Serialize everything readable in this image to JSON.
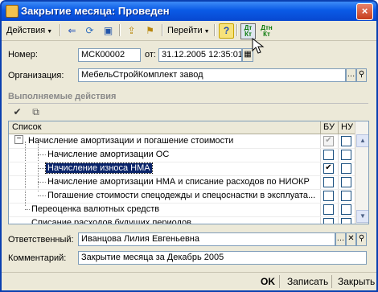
{
  "window": {
    "title": "Закрытие месяца: Проведен",
    "close_glyph": "×"
  },
  "toolbar": {
    "actions_label": "Действия",
    "goto_label": "Перейти",
    "help_glyph": "?",
    "dt_kt_label": "Дт Кт",
    "dtn_kt_label": "Дтн Кт"
  },
  "form": {
    "number_label": "Номер:",
    "number_value": "МСК00002",
    "date_label": "от:",
    "date_value": "31.12.2005 12:35:01",
    "org_label": "Организация:",
    "org_value": "МебельСтройКомплект завод",
    "section_title": "Выполняемые действия",
    "responsible_label": "Ответственный:",
    "responsible_value": "Иванцова Лилия Евгеньевна",
    "comment_label": "Комментарий:",
    "comment_value": "Закрытие месяца за Декабрь 2005"
  },
  "grid": {
    "columns": [
      "Список",
      "БУ",
      "НУ"
    ],
    "rows": [
      {
        "text": "Начисление амортизации и погашение стоимости",
        "level": 0,
        "expander": "−",
        "bu": true,
        "bu_disabled": true,
        "nu": false
      },
      {
        "text": "Начисление амортизации ОС",
        "level": 1,
        "bu": false,
        "nu": false
      },
      {
        "text": "Начисление износа НМА",
        "level": 1,
        "bu": true,
        "nu": false,
        "selected": true
      },
      {
        "text": "Начисление амортизации НМА и списание расходов по НИОКР",
        "level": 1,
        "bu": false,
        "nu": false
      },
      {
        "text": "Погашение стоимости спецодежды и спецоснастки в эксплуата...",
        "level": 1,
        "bu": false,
        "nu": false
      },
      {
        "text": "Переоценка валютных средств",
        "level": 0,
        "bu": false,
        "nu": false
      },
      {
        "text": "Списание расходов будущих периодов",
        "level": 0,
        "bu": false,
        "nu": false
      }
    ]
  },
  "bottom": {
    "ok_label": "OK",
    "save_label": "Записать",
    "close_label": "Закрыть"
  },
  "colors": {
    "title_bar": "#0a5ae6",
    "selection": "#0a246a",
    "window_bg": "#ece9d8"
  }
}
